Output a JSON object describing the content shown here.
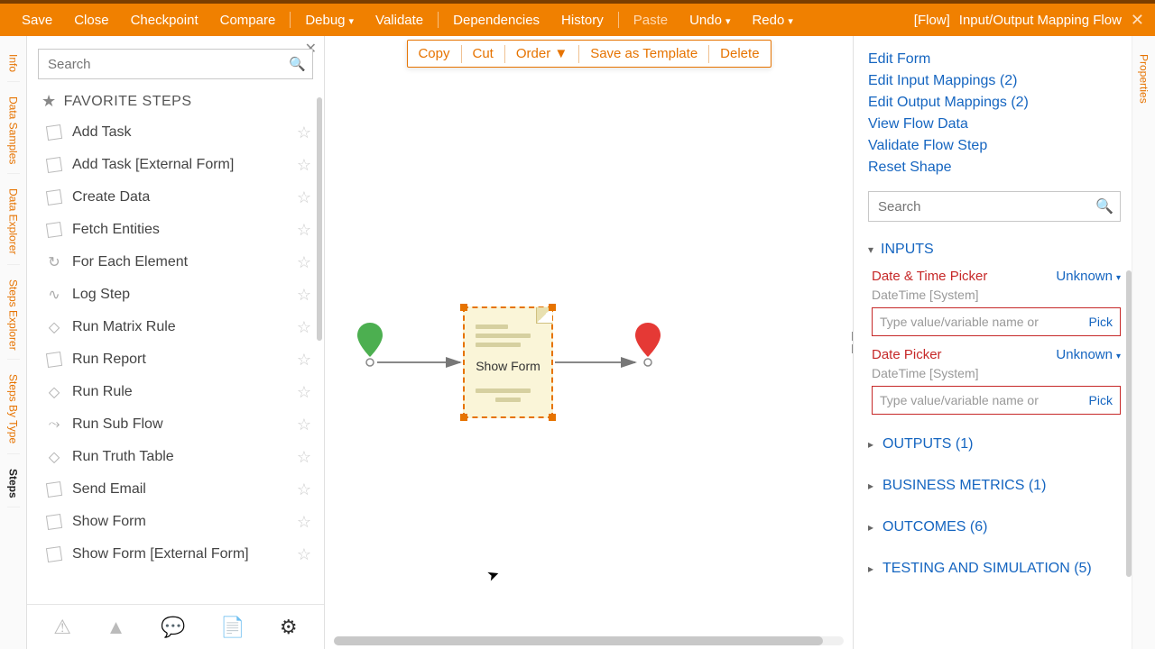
{
  "topbar": {
    "left": [
      "Save",
      "Close",
      "Checkpoint",
      "Compare"
    ],
    "left2": [
      {
        "label": "Debug",
        "caret": true
      },
      {
        "label": "Validate",
        "caret": false
      }
    ],
    "left3": [
      "Dependencies",
      "History"
    ],
    "left4": [
      {
        "label": "Paste",
        "disabled": true
      },
      {
        "label": "Undo",
        "caret": true
      },
      {
        "label": "Redo",
        "caret": true
      }
    ],
    "context_type": "[Flow]",
    "context_title": "Input/Output Mapping Flow"
  },
  "vtabs": [
    "Info",
    "Data Samples",
    "Data Explorer",
    "Steps Explorer",
    "Steps By Type",
    "Steps"
  ],
  "vtab_active_index": 5,
  "left_panel": {
    "search_placeholder": "Search",
    "fav_header": "FAVORITE STEPS",
    "steps": [
      {
        "label": "Add Task",
        "icon": "cube"
      },
      {
        "label": "Add Task [External Form]",
        "icon": "cube"
      },
      {
        "label": "Create Data",
        "icon": "cube"
      },
      {
        "label": "Fetch Entities",
        "icon": "cube"
      },
      {
        "label": "For Each Element",
        "icon": "loop"
      },
      {
        "label": "Log Step",
        "icon": "pulse"
      },
      {
        "label": "Run Matrix Rule",
        "icon": "diamond"
      },
      {
        "label": "Run Report",
        "icon": "cube"
      },
      {
        "label": "Run Rule",
        "icon": "diamond"
      },
      {
        "label": "Run Sub Flow",
        "icon": "subflow"
      },
      {
        "label": "Run Truth Table",
        "icon": "diamond"
      },
      {
        "label": "Send Email",
        "icon": "cube"
      },
      {
        "label": "Show Form",
        "icon": "cube"
      },
      {
        "label": "Show Form [External Form]",
        "icon": "cube"
      }
    ]
  },
  "ctx_menu": [
    {
      "label": "Copy"
    },
    {
      "label": "Cut"
    },
    {
      "label": "Order ▼"
    },
    {
      "label": "Save as Template"
    },
    {
      "label": "Delete"
    }
  ],
  "canvas": {
    "node_label": "Show Form"
  },
  "right_panel": {
    "vtab": "Properties",
    "links": [
      "Edit Form",
      "Edit Input Mappings (2)",
      "Edit Output Mappings (2)",
      "View Flow Data",
      "Validate Flow Step",
      "Reset Shape"
    ],
    "search_placeholder": "Search",
    "inputs_header": "INPUTS",
    "fields": [
      {
        "name": "Date & Time Picker",
        "mode": "Unknown",
        "type": "DateTime [System]",
        "placeholder": "Type value/variable name or",
        "pick": "Pick"
      },
      {
        "name": "Date Picker",
        "mode": "Unknown",
        "type": "DateTime [System]",
        "placeholder": "Type value/variable name or",
        "pick": "Pick"
      }
    ],
    "collapsed_sections": [
      "OUTPUTS (1)",
      "BUSINESS METRICS (1)",
      "OUTCOMES (6)",
      "TESTING AND SIMULATION (5)"
    ]
  }
}
